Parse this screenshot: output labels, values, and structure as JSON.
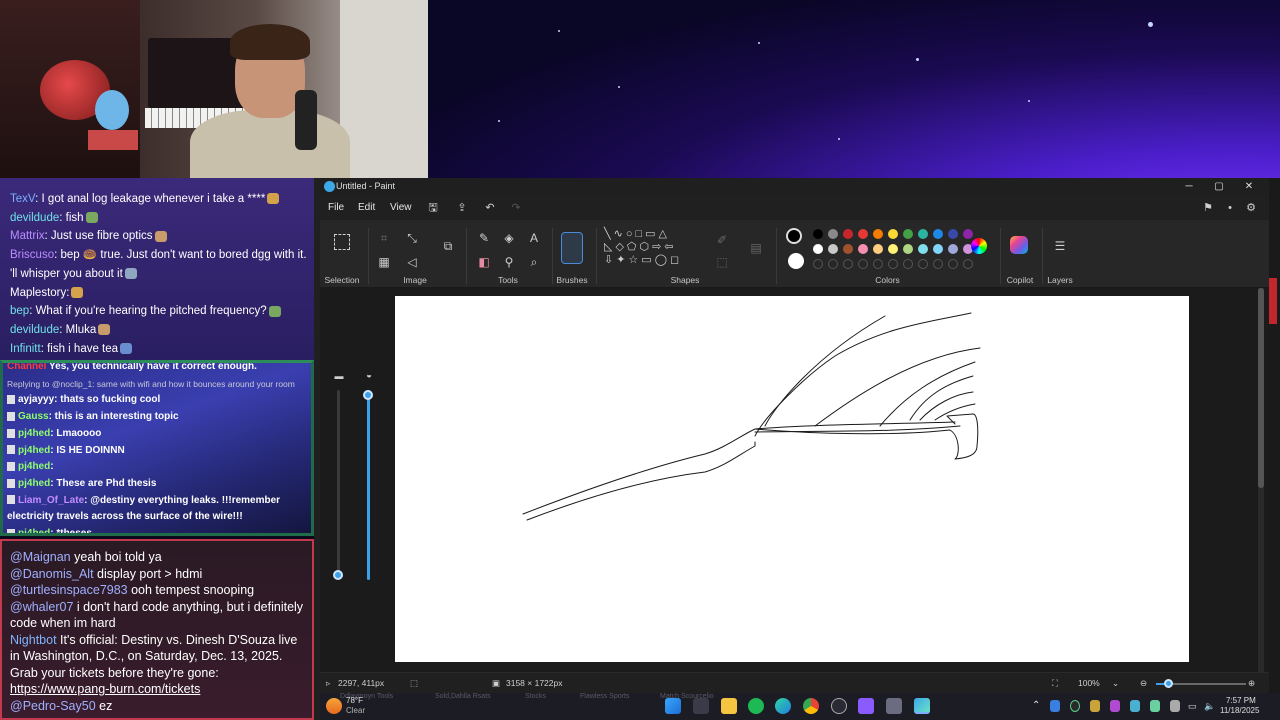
{
  "chat_top": [
    {
      "user": "TexV",
      "color": "blue",
      "text": ": I got anal log leakage whenever i take a ****"
    },
    {
      "user": "devildude",
      "color": "cyan",
      "text": ": fish"
    },
    {
      "user": "Mattrix",
      "color": "purple",
      "text": ": Just use fibre optics"
    },
    {
      "user": "Briscuso",
      "color": "purple",
      "text": ": bep 🍩 true. Just don't want to bored dgg with it."
    },
    {
      "user": "",
      "color": "white",
      "text": "'ll whisper you about it"
    },
    {
      "user": "Maplestory",
      "color": "white",
      "text": ":"
    },
    {
      "user": "bep",
      "color": "cyan",
      "text": ": What if you're hearing the pitched frequency?"
    },
    {
      "user": "devildude",
      "color": "cyan",
      "text": ": Mluka"
    },
    {
      "user": "Infinitt",
      "color": "cyan",
      "text": ": fish i have tea"
    }
  ],
  "chat_mid": {
    "cutoff_line": {
      "user": "Channel",
      "text": " Yes, you technically have it correct enough."
    },
    "reply_line": "Replying to @noclip_1: same with wifi and how it bounces around your room",
    "lines": [
      {
        "user": "ayjayyy",
        "color": "white",
        "text": ": thats so fucking cool"
      },
      {
        "user": "Gauss",
        "color": "grn",
        "text": ": this is an interesting topic"
      },
      {
        "user": "pj4hed",
        "color": "grn",
        "text": ": Lmaoooo"
      },
      {
        "user": "pj4hed",
        "color": "grn",
        "text": ": IS HE DOINNN"
      },
      {
        "user": "pj4hed",
        "color": "grn",
        "text": ":"
      },
      {
        "user": "pj4hed",
        "color": "grn",
        "text": ": These are Phd thesis"
      },
      {
        "user": "Liam_Of_Late",
        "color": "pur",
        "text": ": @destiny everything leaks. !!!remember"
      },
      {
        "user": "",
        "color": "white",
        "text": "electricity travels across the surface of the wire!!!"
      },
      {
        "user": "pj4hed",
        "color": "grn",
        "text": ": *theses"
      }
    ]
  },
  "chat_bottom": [
    {
      "user": "@Maignan",
      "text": " yeah boi told ya"
    },
    {
      "user": "@Danomis_Alt",
      "text": " display port > hdmi"
    },
    {
      "user": "@turtlesinspace7983",
      "text": " ooh tempest snooping"
    },
    {
      "user": "@whaler07",
      "text": " i don't hard code anything, but i definitely code when im hard"
    },
    {
      "user": "Nightbot",
      "text": " It's official: Destiny vs. Dinesh D'Souza live in Washington, D.C., on Saturday, Dec. 13, 2025. Grab your tickets before they're gone: ",
      "link": "https://www.pang-burn.com/tickets"
    },
    {
      "user": "@Pedro-Say50",
      "text": " ez"
    }
  ],
  "paint": {
    "title": "Untitled - Paint",
    "menu": {
      "file": "File",
      "edit": "Edit",
      "view": "View"
    },
    "groups": {
      "selection": "Selection",
      "image": "Image",
      "tools": "Tools",
      "brushes": "Brushes",
      "shapes": "Shapes",
      "colors": "Colors",
      "copilot": "Copilot",
      "layers": "Layers"
    },
    "palette_row1": [
      "#000000",
      "#8a8a8a",
      "#c8262c",
      "#e53935",
      "#f57c00",
      "#fdd835",
      "#43a047",
      "#2bb5a0",
      "#1e88e5",
      "#3949ab",
      "#8e24aa"
    ],
    "palette_row2": [
      "#ffffff",
      "#c8c8c8",
      "#a0522d",
      "#f48fb1",
      "#ffcc80",
      "#fff176",
      "#aed581",
      "#80deea",
      "#81d4fa",
      "#9fa8da",
      "#ce93d8"
    ],
    "status": {
      "cursor": "2297, 411px",
      "size": "3158 × 1722px",
      "zoom": "100%"
    }
  },
  "taskbar": {
    "weather_temp": "78°F",
    "weather_desc": "Clear",
    "time": "7:57 PM",
    "date": "11/18/2025"
  }
}
